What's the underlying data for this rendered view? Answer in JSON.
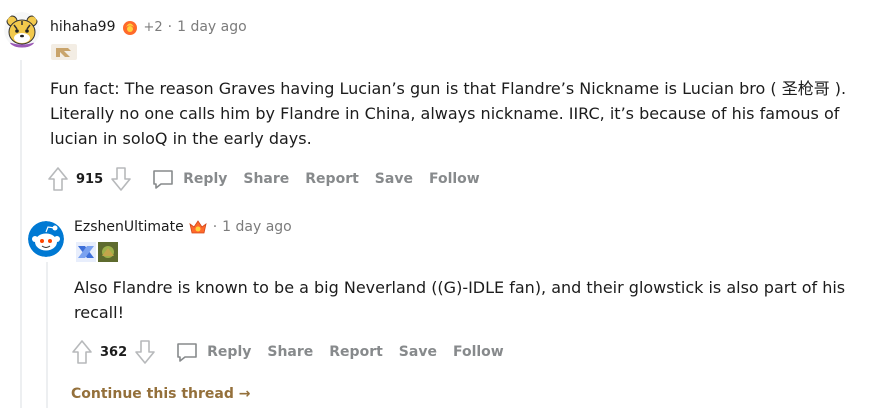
{
  "comments": [
    {
      "username": "hihaha99",
      "points": "+2",
      "separator": "·",
      "time": "1 day ago",
      "body": "Fun fact: The reason Graves having Lucian’s gun is that Flandre’s Nickname is Lucian bro ( 圣枪哥 ). Literally no one calls him by Flandre in China, always nickname. IIRC, it’s because of his famous of lucian in soloQ in the early days.",
      "score": "915",
      "actions": {
        "reply": "Reply",
        "share": "Share",
        "report": "Report",
        "save": "Save",
        "follow": "Follow"
      }
    },
    {
      "username": "EzshenUltimate",
      "separator": "·",
      "time": "1 day ago",
      "body": "Also Flandre is known to be a big Neverland ((G)-IDLE fan), and their glowstick is also part of his recall!",
      "score": "362",
      "actions": {
        "reply": "Reply",
        "share": "Share",
        "report": "Report",
        "save": "Save",
        "follow": "Follow"
      }
    }
  ],
  "continue_thread": "Continue this thread",
  "continue_arrow": "→",
  "colors": {
    "thread_line": "#edeff1",
    "muted": "#878a8c",
    "continue": "#94703b",
    "award_orange": "#ff6a2b"
  },
  "icons": [
    "tiger-avatar",
    "snoo-avatar",
    "award-icon",
    "flair-badge",
    "upvote-icon",
    "downvote-icon",
    "comment-icon"
  ]
}
